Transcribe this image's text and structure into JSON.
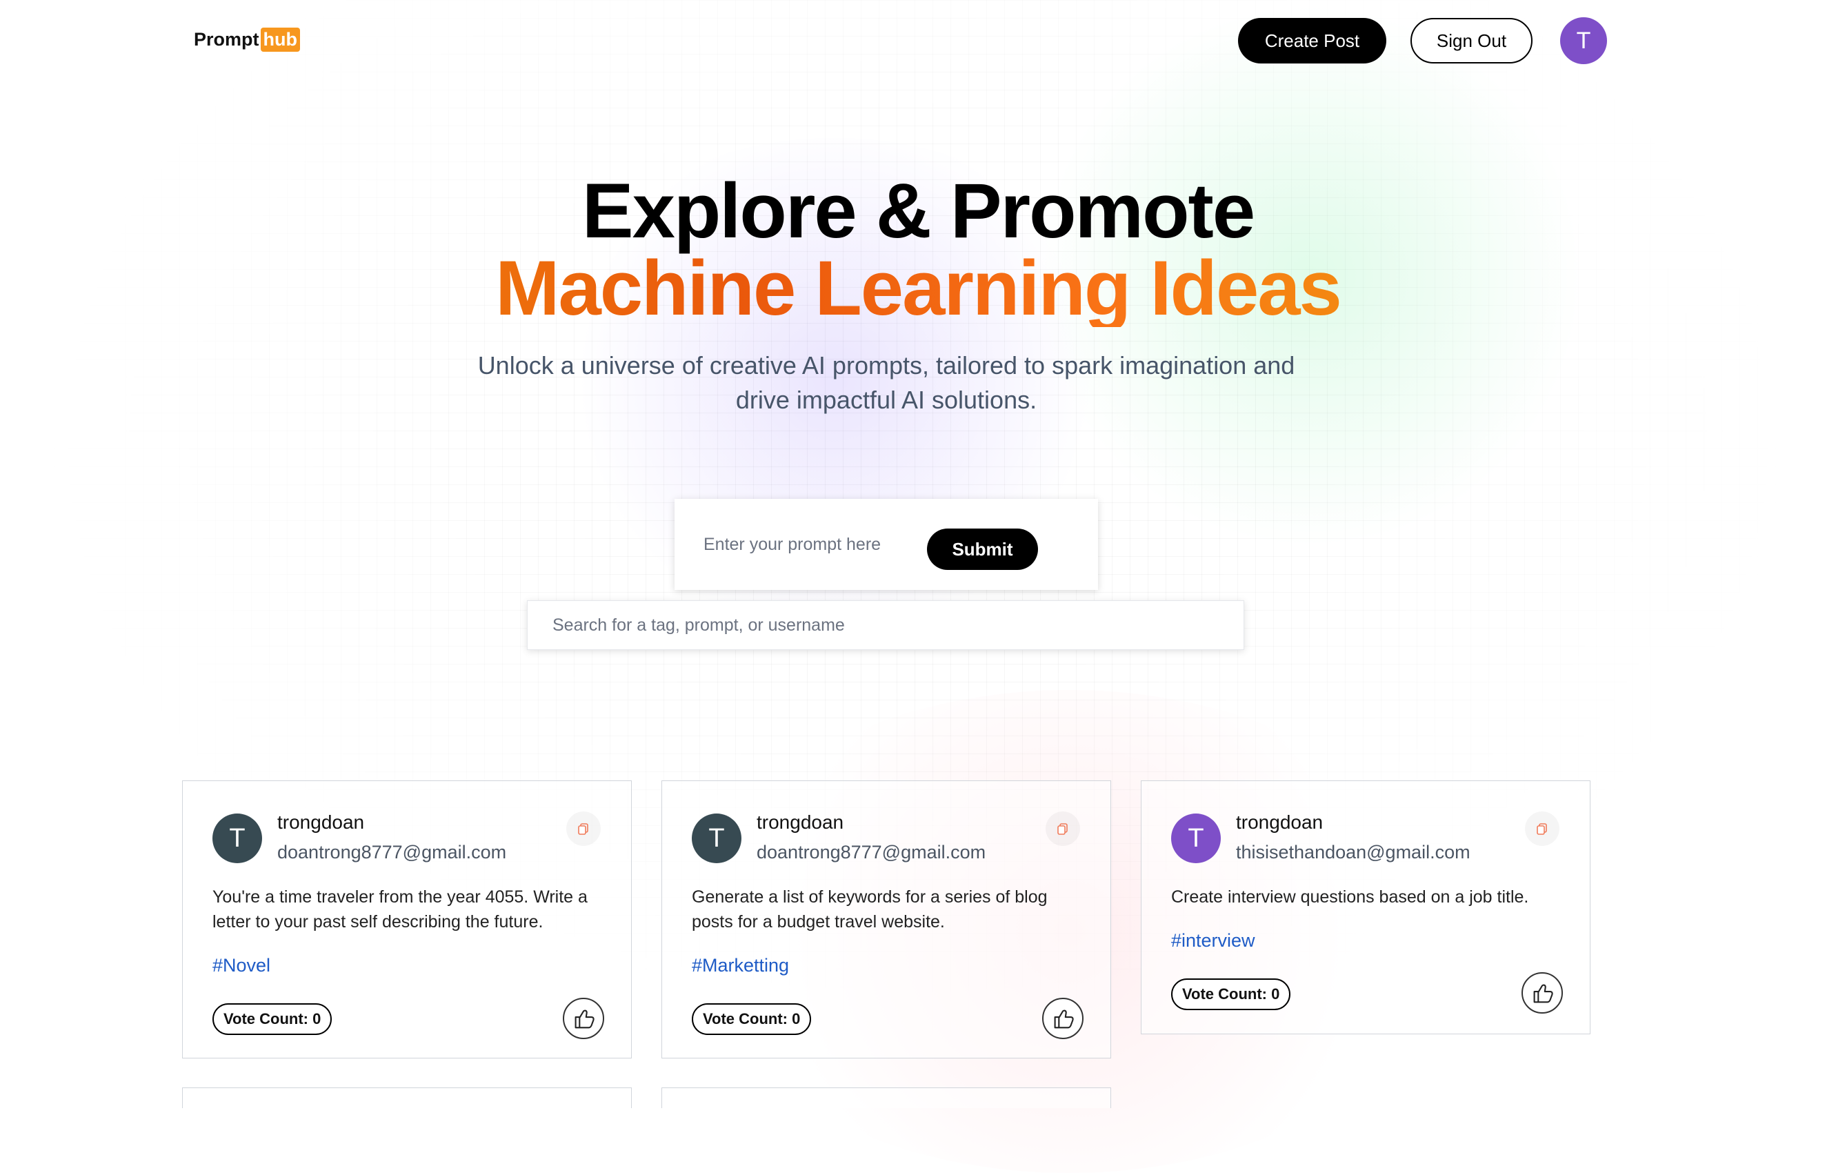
{
  "header": {
    "logo_text": "Prompt",
    "logo_badge": "hub",
    "create_label": "Create Post",
    "signout_label": "Sign Out",
    "avatar_initial": "T"
  },
  "hero": {
    "title_line1": "Explore & Promote",
    "title_line2": "Machine Learning Ideas",
    "subtitle": "Unlock a universe of creative AI prompts, tailored to spark imagination and drive impactful AI solutions."
  },
  "prompt": {
    "placeholder": "Enter your prompt here",
    "submit_label": "Submit"
  },
  "search": {
    "placeholder": "Search for a tag, prompt, or username"
  },
  "cards": [
    {
      "initial": "T",
      "avatar_color": "#374a52",
      "username": "trongdoan",
      "email": "doantrong8777@gmail.com",
      "text": "You're a time traveler from the year 4055. Write a letter to your past self describing the future.",
      "tag": "#Novel",
      "vote_label": "Vote Count: 0"
    },
    {
      "initial": "T",
      "avatar_color": "#374a52",
      "username": "trongdoan",
      "email": "doantrong8777@gmail.com",
      "text": "Generate a list of keywords for a series of blog posts for a budget travel website.",
      "tag": "#Marketting",
      "vote_label": "Vote Count: 0"
    },
    {
      "initial": "T",
      "avatar_color": "#7e4fc8",
      "username": "trongdoan",
      "email": "thisisethandoan@gmail.com",
      "text": "Create interview questions based on a job title.",
      "tag": "#interview",
      "vote_label": "Vote Count: 0"
    }
  ],
  "colors": {
    "accent_orange": "#f7971e",
    "tag_blue": "#1e5bc6",
    "avatar_purple": "#7e4fc8"
  },
  "icons": {
    "copy": "copy-icon",
    "like": "thumbs-up-icon"
  }
}
